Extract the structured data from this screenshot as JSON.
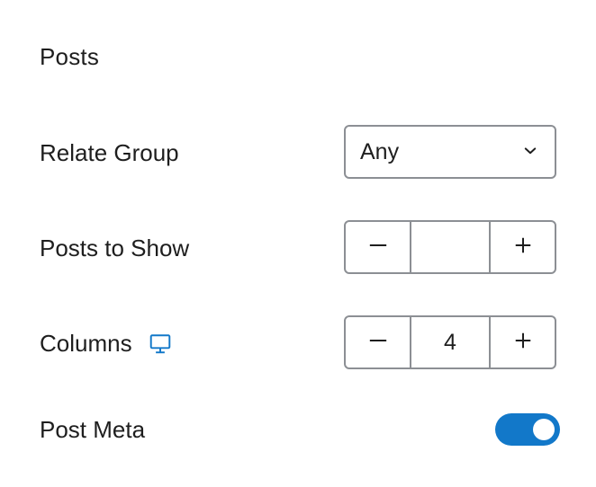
{
  "section": {
    "title": "Posts"
  },
  "relate_group": {
    "label": "Relate Group",
    "selected": "Any"
  },
  "posts_to_show": {
    "label": "Posts to Show",
    "value": "",
    "decrement": "−",
    "increment": "+"
  },
  "columns": {
    "label": "Columns",
    "value": "4",
    "device_icon": "desktop-monitor-icon"
  },
  "post_meta": {
    "label": "Post Meta",
    "enabled": true
  },
  "colors": {
    "accent": "#1278c9",
    "text": "#1e1e1e",
    "border": "#8c8f94"
  }
}
